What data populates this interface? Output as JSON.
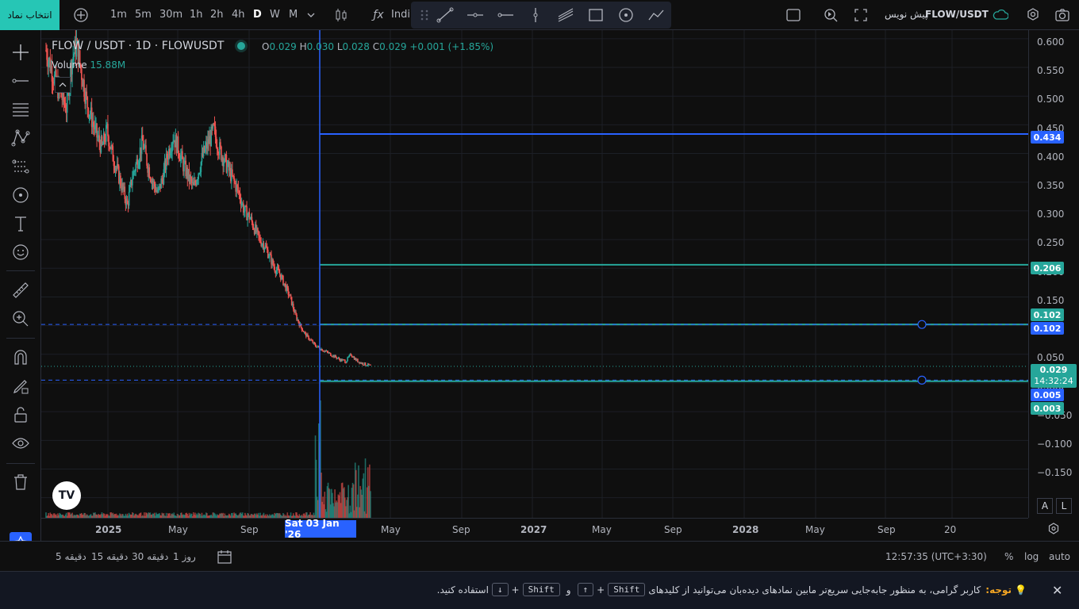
{
  "topbar": {
    "symbol_button": "انتخاب نماد",
    "intervals": [
      "1m",
      "5m",
      "30m",
      "1h",
      "2h",
      "4h",
      "D",
      "W",
      "M"
    ],
    "active_interval": "D",
    "indicators_label": "Indi",
    "title": "FLOW/USDT",
    "title_suffix": "پیش نویس"
  },
  "legend": {
    "symbol": "FLOW / USDT · 1D · FLOWUSDT",
    "o_label": "O",
    "o": "0.029",
    "h_label": "H",
    "h": "0.030",
    "l_label": "L",
    "l": "0.028",
    "c_label": "C",
    "c": "0.029",
    "change": "+0.001 (+1.85%)",
    "volume_label": "Volume",
    "volume": "15.88M"
  },
  "price_axis": {
    "ticks": [
      "0.600",
      "0.550",
      "0.500",
      "0.450",
      "0.400",
      "0.350",
      "0.300",
      "0.250",
      "0.200",
      "0.150",
      "0.100",
      "0.050",
      "0.000",
      "−0.050",
      "−0.100",
      "−0.150"
    ],
    "badges": {
      "blue_top": "0.434",
      "green_mid": "0.206",
      "green_low": "0.102",
      "blue_low": "0.102",
      "last": "0.029",
      "countdown": "14:32:24",
      "blue_bottom": "0.005",
      "green_bottom": "0.003"
    },
    "auto_btn": "A",
    "log_btn": "L"
  },
  "time_axis": {
    "labels": [
      "2025",
      "May",
      "Sep",
      "May",
      "Sep",
      "2027",
      "May",
      "Sep",
      "2028",
      "May",
      "Sep",
      "20"
    ],
    "crosshair": "Sat 03 Jan '26"
  },
  "bottom_bar": {
    "ranges": [
      "5 دقیقه",
      "15 دقیقه",
      "30 دقیقه",
      "1 روز"
    ],
    "clock": "12:57:35 (UTC+3:30)",
    "percent": "%",
    "log": "log",
    "auto": "auto"
  },
  "notice": {
    "label": "توجه:",
    "text_1": "کاربر گرامی، به منظور جابه‌جایی سریع‌تر مابین نمادهای دیده‌بان می‌توانید از کلیدهای",
    "key_shift": "Shift",
    "plus": "+",
    "key_up": "↑",
    "and": "و",
    "key_down": "↓",
    "text_2": "استفاده کنید.",
    "close": "✕"
  },
  "chart_data": {
    "type": "candlestick",
    "symbol": "FLOW / USDT",
    "interval": "1D",
    "ylim": [
      -0.19,
      0.62
    ],
    "close_series": [
      0.58,
      0.55,
      0.52,
      0.5,
      0.48,
      0.56,
      0.59,
      0.54,
      0.49,
      0.46,
      0.43,
      0.41,
      0.44,
      0.4,
      0.37,
      0.34,
      0.31,
      0.36,
      0.39,
      0.42,
      0.38,
      0.35,
      0.33,
      0.36,
      0.4,
      0.43,
      0.41,
      0.38,
      0.36,
      0.34,
      0.37,
      0.4,
      0.42,
      0.44,
      0.41,
      0.39,
      0.37,
      0.35,
      0.33,
      0.3,
      0.29,
      0.27,
      0.25,
      0.24,
      0.22,
      0.2,
      0.19,
      0.17,
      0.15,
      0.12,
      0.1,
      0.085,
      0.075,
      0.065,
      0.06,
      0.055,
      0.05,
      0.045,
      0.04,
      0.038,
      0.05,
      0.04,
      0.035,
      0.032,
      0.029
    ],
    "horizontal_lines": [
      {
        "value": 0.434,
        "color": "#2962ff",
        "style": "solid"
      },
      {
        "value": 0.206,
        "color": "#26a69a",
        "style": "solid"
      },
      {
        "value": 0.102,
        "color": "#26a69a",
        "style": "solid"
      },
      {
        "value": 0.102,
        "color": "#2962ff",
        "style": "dashed"
      },
      {
        "value": 0.005,
        "color": "#2962ff",
        "style": "dashed"
      },
      {
        "value": 0.003,
        "color": "#26a69a",
        "style": "solid"
      }
    ],
    "colors": {
      "up": "#26a69a",
      "down": "#ef5350",
      "crosshair": "#2962ff"
    }
  }
}
